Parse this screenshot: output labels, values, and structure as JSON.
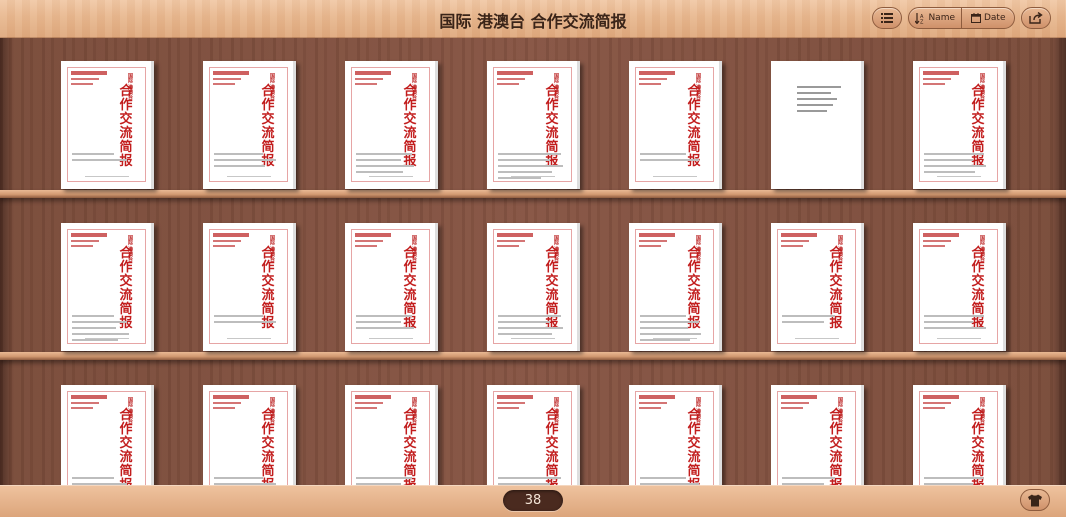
{
  "header": {
    "title": "国际 港澳台 合作交流简报",
    "sort_name_label": "Name",
    "sort_date_label": "Date"
  },
  "icons": {
    "list": "list-icon",
    "sort": "sort-icon",
    "calendar": "calendar-icon",
    "share": "share-icon",
    "theme": "shirt-icon"
  },
  "colors": {
    "wood_light": "#e8b88f",
    "wood_dark": "#7a4c3a",
    "cover_red": "#c21d1d"
  },
  "book_cover": {
    "subtitle": "国际 港澳台",
    "title": "合作交流简报"
  },
  "footer": {
    "count": "38"
  }
}
